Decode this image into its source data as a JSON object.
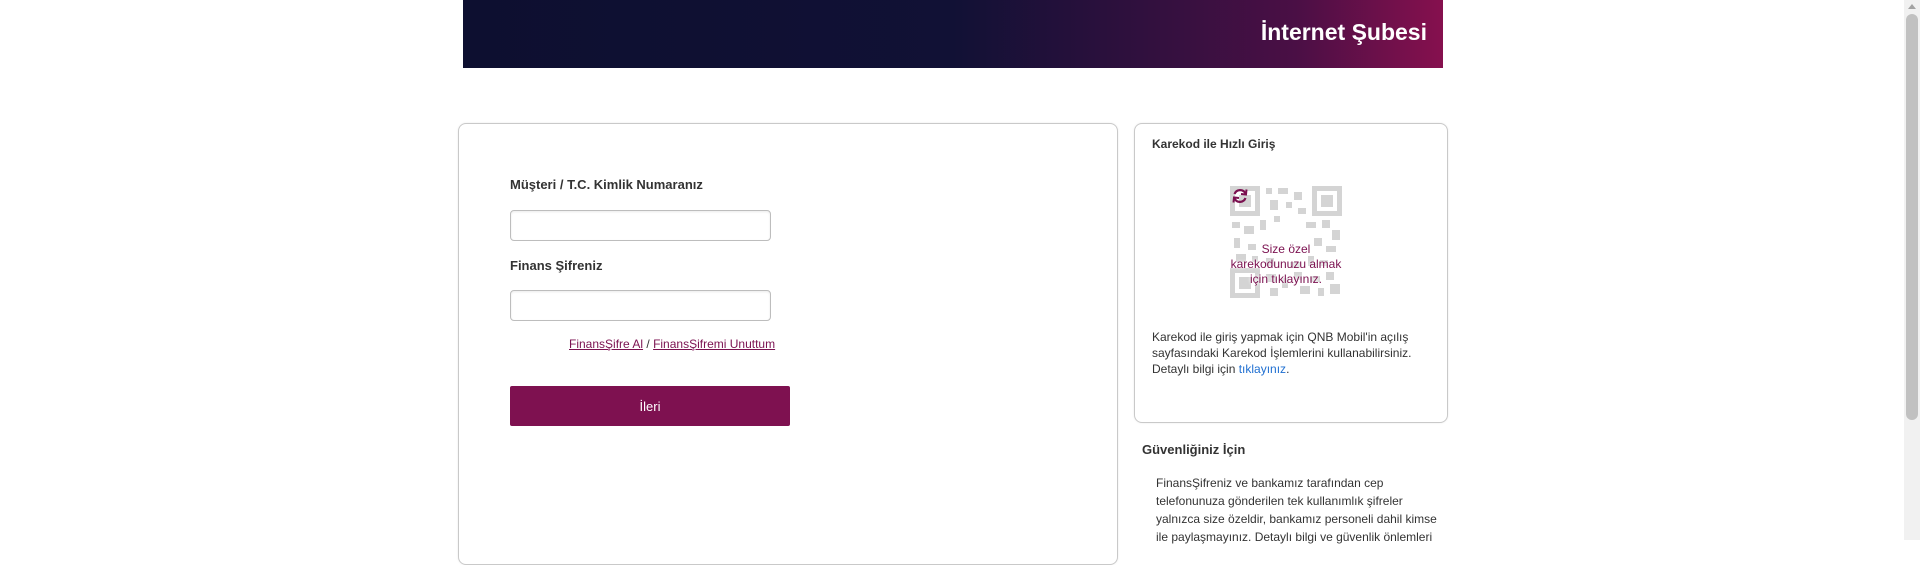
{
  "header": {
    "title": "İnternet Şubesi"
  },
  "login": {
    "customer_label": "Müşteri / T.C. Kimlik Numaranız",
    "customer_value": "",
    "password_label": "Finans Şifreniz",
    "password_value": "",
    "get_password_link": "FinansŞifre Al",
    "separator": " / ",
    "forgot_password_link": "FinansŞifremi Unuttum",
    "next_button": "İleri"
  },
  "qr": {
    "title": "Karekod ile Hızlı Giriş",
    "overlay_text": "Size özel karekodunuzu almak için tıklayınız.",
    "info_text": "Karekod ile giriş yapmak için QNB Mobil'in açılış sayfasındaki Karekod İşlemlerini kullanabilirsiniz. Detaylı bilgi için ",
    "info_link": "tıklayınız",
    "info_end": ".",
    "accent_color": "#7b1150"
  },
  "security": {
    "title": "Güvenliğiniz İçin",
    "text": "FinansŞifreniz ve bankamız tarafından cep telefonunuza gönderilen tek kullanımlık şifreler yalnızca size özeldir, bankamız personeli dahil kimse ile paylaşmayınız. Detaylı bilgi ve güvenlik önlemleri"
  },
  "colors": {
    "primary": "#7e1150",
    "header_start": "#0d0f30",
    "header_end": "#86104e",
    "link": "#1f6fd1"
  }
}
